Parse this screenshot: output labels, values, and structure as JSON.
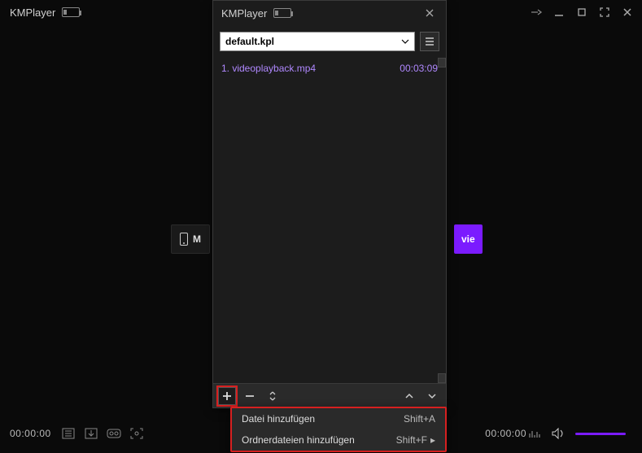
{
  "main": {
    "title": "KMPlayer"
  },
  "center": {
    "left_label_fragment": "M",
    "right_label_fragment": "vie"
  },
  "bottom": {
    "time_left": "00:00:00",
    "time_right": "00:00:00"
  },
  "dialog": {
    "title": "KMPlayer",
    "playlist_name": "default.kpl",
    "items": [
      {
        "label": "1. videoplayback.mp4",
        "duration": "00:03:09"
      }
    ]
  },
  "menu": {
    "row1": {
      "label": "Datei hinzufügen",
      "shortcut": "Shift+A"
    },
    "row2": {
      "label": "Ordnerdateien hinzufügen",
      "shortcut": "Shift+F"
    }
  }
}
